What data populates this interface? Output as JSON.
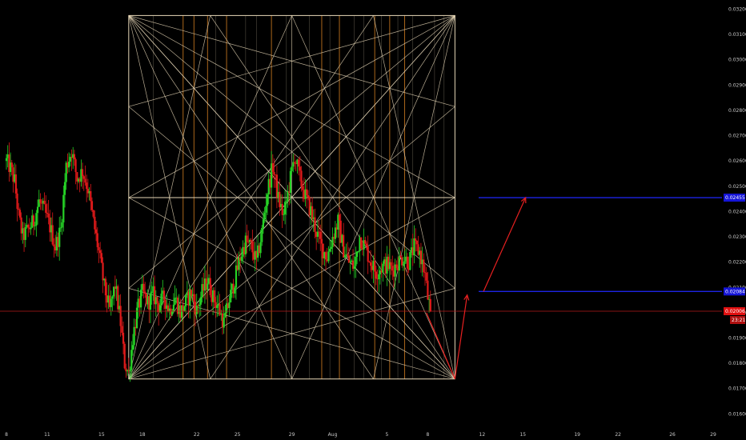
{
  "chart_data": {
    "type": "candlestick",
    "y_axis": {
      "range": [
        0.0156,
        0.0323
      ],
      "ticks": [
        "0.03200",
        "0.03100",
        "0.03000",
        "0.02900",
        "0.02800",
        "0.02700",
        "0.02600",
        "0.02500",
        "0.02400",
        "0.02300",
        "0.02200",
        "0.02100",
        "0.02000",
        "0.01900",
        "0.01800",
        "0.01700",
        "0.01600"
      ],
      "tick_values": [
        0.032,
        0.031,
        0.03,
        0.029,
        0.028,
        0.027,
        0.026,
        0.025,
        0.024,
        0.023,
        0.022,
        0.021,
        0.02,
        0.019,
        0.018,
        0.017,
        0.016
      ]
    },
    "x_axis": {
      "range": [
        7.6,
        30.2
      ],
      "ticks": [
        {
          "label": "8",
          "day": 8
        },
        {
          "label": "11",
          "day": 11
        },
        {
          "label": "15",
          "day": 15
        },
        {
          "label": "18",
          "day": 18
        },
        {
          "label": "22",
          "day": 22
        },
        {
          "label": "25",
          "day": 25
        },
        {
          "label": "29",
          "day": 29
        },
        {
          "label": "Aug",
          "day": 32
        },
        {
          "label": "5",
          "day": 36
        },
        {
          "label": "8",
          "day": 39
        },
        {
          "label": "12",
          "day": 43
        },
        {
          "label": "15",
          "day": 46
        },
        {
          "label": "19",
          "day": 50
        },
        {
          "label": "22",
          "day": 53
        },
        {
          "label": "26",
          "day": 57
        },
        {
          "label": "29",
          "day": 60
        }
      ]
    },
    "price_path": [
      [
        8.0,
        0.026
      ],
      [
        8.3,
        0.0257
      ],
      [
        8.6,
        0.0252
      ],
      [
        8.9,
        0.0238
      ],
      [
        9.2,
        0.023
      ],
      [
        9.6,
        0.0233
      ],
      [
        10.0,
        0.0236
      ],
      [
        10.4,
        0.0244
      ],
      [
        10.8,
        0.024
      ],
      [
        11.2,
        0.0234
      ],
      [
        11.6,
        0.0226
      ],
      [
        12.0,
        0.0233
      ],
      [
        12.4,
        0.0258
      ],
      [
        12.8,
        0.0264
      ],
      [
        13.2,
        0.0253
      ],
      [
        13.6,
        0.0256
      ],
      [
        14.0,
        0.0249
      ],
      [
        14.4,
        0.0236
      ],
      [
        14.8,
        0.0224
      ],
      [
        15.2,
        0.021
      ],
      [
        15.6,
        0.0201
      ],
      [
        16.0,
        0.0211
      ],
      [
        16.4,
        0.0196
      ],
      [
        16.7,
        0.018
      ],
      [
        17.0,
        0.0176
      ],
      [
        17.3,
        0.019
      ],
      [
        17.6,
        0.02
      ],
      [
        18.0,
        0.0208
      ],
      [
        18.4,
        0.0204
      ],
      [
        18.8,
        0.0207
      ],
      [
        19.2,
        0.0203
      ],
      [
        19.6,
        0.0206
      ],
      [
        20.0,
        0.0201
      ],
      [
        20.4,
        0.0206
      ],
      [
        20.8,
        0.02
      ],
      [
        21.2,
        0.0204
      ],
      [
        21.6,
        0.0208
      ],
      [
        22.0,
        0.0201
      ],
      [
        22.4,
        0.0208
      ],
      [
        22.8,
        0.0213
      ],
      [
        23.2,
        0.0206
      ],
      [
        23.6,
        0.0202
      ],
      [
        24.0,
        0.0196
      ],
      [
        24.4,
        0.0205
      ],
      [
        24.8,
        0.0213
      ],
      [
        25.2,
        0.0222
      ],
      [
        25.6,
        0.0228
      ],
      [
        26.0,
        0.0226
      ],
      [
        26.4,
        0.022
      ],
      [
        26.8,
        0.0232
      ],
      [
        27.2,
        0.0248
      ],
      [
        27.6,
        0.0258
      ],
      [
        28.0,
        0.0245
      ],
      [
        28.4,
        0.0238
      ],
      [
        28.8,
        0.025
      ],
      [
        29.2,
        0.0262
      ],
      [
        29.6,
        0.0253
      ],
      [
        30.0,
        0.0246
      ],
      [
        30.4,
        0.024
      ],
      [
        30.8,
        0.0232
      ],
      [
        31.2,
        0.0226
      ],
      [
        31.6,
        0.0222
      ],
      [
        32.0,
        0.023
      ],
      [
        32.4,
        0.0236
      ],
      [
        32.8,
        0.0225
      ],
      [
        33.2,
        0.022
      ],
      [
        33.6,
        0.0218
      ],
      [
        34.0,
        0.023
      ],
      [
        34.4,
        0.0226
      ],
      [
        34.8,
        0.022
      ],
      [
        35.2,
        0.0216
      ],
      [
        35.6,
        0.0218
      ],
      [
        36.0,
        0.0219
      ],
      [
        36.4,
        0.0217
      ],
      [
        36.8,
        0.022
      ],
      [
        37.2,
        0.0222
      ],
      [
        37.6,
        0.022
      ],
      [
        38.0,
        0.0226
      ],
      [
        38.4,
        0.0224
      ],
      [
        38.8,
        0.0215
      ],
      [
        39.0,
        0.0206
      ],
      [
        39.2,
        0.0201
      ]
    ],
    "last_price": {
      "label": "0.02006",
      "value": 0.02006,
      "countdown": "23:21"
    },
    "levels": [
      {
        "label": "0.02455",
        "value": 0.02455
      },
      {
        "label": "0.02084",
        "value": 0.02084
      }
    ],
    "gann_box": {
      "x_start": 17.0,
      "x_end": 41.0,
      "y_low": 0.01738,
      "y_high": 0.03175,
      "y_mid": 0.02455
    },
    "vertical_lines": {
      "orange": [
        21.0,
        21.8,
        22.8,
        24.2,
        27.5,
        31.2,
        32.5,
        35.1,
        36.2,
        37.3
      ],
      "light": [
        18.8,
        23.4,
        25.6,
        26.4,
        28.6,
        30.3,
        31.8,
        33.6,
        34.3,
        35.6,
        36.8,
        37.9,
        39.5,
        40.2
      ]
    },
    "projection_path": [
      [
        38.9,
        0.02
      ],
      [
        41.0,
        0.01738
      ],
      [
        41.9,
        0.0207
      ],
      [
        43.1,
        0.02084
      ],
      [
        44.6,
        0.02084
      ],
      [
        46.2,
        0.02455
      ]
    ],
    "colors": {
      "up": "#26d326",
      "down": "#e01a1a",
      "box": "#e8d8b8",
      "orange_lines": "#c87820",
      "level": "#1e24e6",
      "projection": "#e82020",
      "last_price_line": "#b41a1a",
      "tag_bg": "#e01010",
      "level_tag_bg": "#1515d8"
    }
  }
}
